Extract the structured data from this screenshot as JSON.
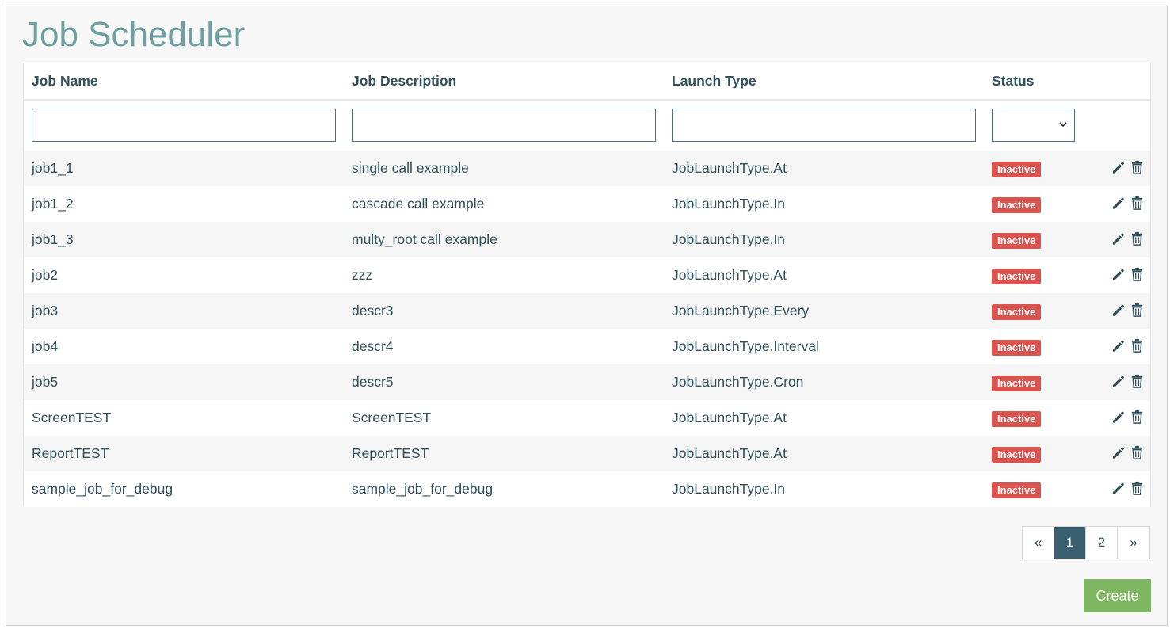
{
  "page": {
    "title": "Job Scheduler"
  },
  "table": {
    "headers": {
      "name": "Job Name",
      "description": "Job Description",
      "launch_type": "Launch Type",
      "status": "Status"
    },
    "filters": {
      "name": "",
      "description": "",
      "launch_type": "",
      "status": ""
    },
    "rows": [
      {
        "name": "job1_1",
        "description": "single call example",
        "launch_type": "JobLaunchType.At",
        "status": "Inactive"
      },
      {
        "name": "job1_2",
        "description": "cascade call example",
        "launch_type": "JobLaunchType.In",
        "status": "Inactive"
      },
      {
        "name": "job1_3",
        "description": "multy_root call example",
        "launch_type": "JobLaunchType.In",
        "status": "Inactive"
      },
      {
        "name": "job2",
        "description": "zzz",
        "launch_type": "JobLaunchType.At",
        "status": "Inactive"
      },
      {
        "name": "job3",
        "description": "descr3",
        "launch_type": "JobLaunchType.Every",
        "status": "Inactive"
      },
      {
        "name": "job4",
        "description": "descr4",
        "launch_type": "JobLaunchType.Interval",
        "status": "Inactive"
      },
      {
        "name": "job5",
        "description": "descr5",
        "launch_type": "JobLaunchType.Cron",
        "status": "Inactive"
      },
      {
        "name": "ScreenTEST",
        "description": "ScreenTEST",
        "launch_type": "JobLaunchType.At",
        "status": "Inactive"
      },
      {
        "name": "ReportTEST",
        "description": "ReportTEST",
        "launch_type": "JobLaunchType.At",
        "status": "Inactive"
      },
      {
        "name": "sample_job_for_debug",
        "description": "sample_job_for_debug",
        "launch_type": "JobLaunchType.In",
        "status": "Inactive"
      }
    ],
    "row_icons": [
      "pencil-icon",
      "trash-icon"
    ]
  },
  "pagination": {
    "prev": "«",
    "pages": [
      "1",
      "2"
    ],
    "current": "1",
    "next": "»"
  },
  "actions": {
    "create_label": "Create"
  },
  "colors": {
    "title": "#6e9fa1",
    "text": "#2f4f5a",
    "inactive_badge": "#d9534f",
    "active_page": "#3a5f70",
    "create_button": "#7fb661"
  }
}
